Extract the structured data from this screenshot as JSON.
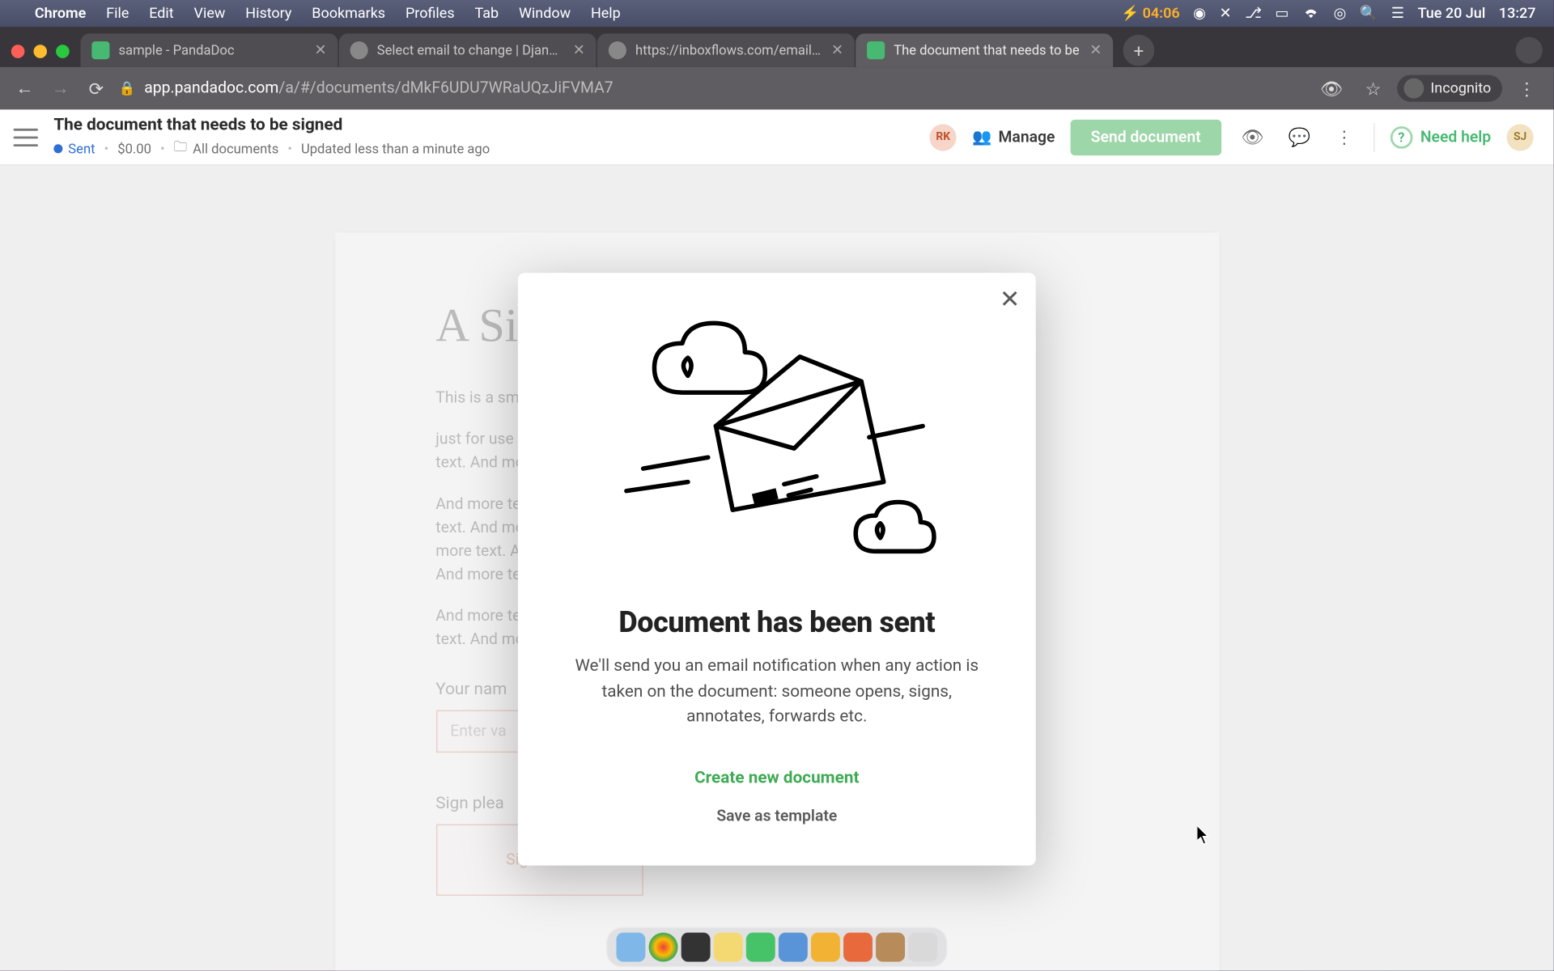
{
  "menubar": {
    "app": "Chrome",
    "items": [
      "File",
      "Edit",
      "View",
      "History",
      "Bookmarks",
      "Profiles",
      "Tab",
      "Window",
      "Help"
    ],
    "battery": "04:06",
    "date": "Tue 20 Jul",
    "time": "13:27"
  },
  "tabs": [
    {
      "title": "sample - PandaDoc",
      "favicon": "pd"
    },
    {
      "title": "Select email to change | Django",
      "favicon": "gl"
    },
    {
      "title": "https://inboxflows.com/emails/",
      "favicon": "gl"
    },
    {
      "title": "The document that needs to be",
      "favicon": "pd",
      "active": true
    }
  ],
  "url": {
    "host": "app.pandadoc.com",
    "path": "/a/#/documents/dMkF6UDU7WRaUQzJiFVMA7",
    "incognito_label": "Incognito"
  },
  "appbar": {
    "title": "The document that needs to be signed",
    "status": "Sent",
    "amount": "$0.00",
    "folder": "All documents",
    "updated": "Updated less than a minute ago",
    "avatar1": "RK",
    "manage": "Manage",
    "send": "Send document",
    "needhelp": "Need help",
    "avatar2": "SJ"
  },
  "doc": {
    "heading": "A Sim",
    "p1": "This is a sm",
    "p2a": "just for use i",
    "p2b": "text. And mo",
    "p3a": "And more te",
    "p3b": "text. And mo",
    "p3c": "more text. A",
    "p3d": "And more te",
    "p4a": "And more te",
    "p4b": "text. And mo",
    "name_label": "Your nam",
    "name_placeholder": "Enter va",
    "sign_label": "Sign plea",
    "sig_label": "Signature"
  },
  "modal": {
    "title": "Document has been sent",
    "body": "We'll send you an email notification when any action is taken on the document: someone opens, signs, annotates, forwards etc.",
    "primary": "Create new document",
    "secondary": "Save as template"
  },
  "dock_colors": [
    "#7fb8e8",
    "#fff",
    "#333",
    "#f4d973",
    "#46c268",
    "#5a94d8",
    "#f2b233",
    "#e86a3c",
    "#b88b5a",
    "#d9d9d9"
  ]
}
